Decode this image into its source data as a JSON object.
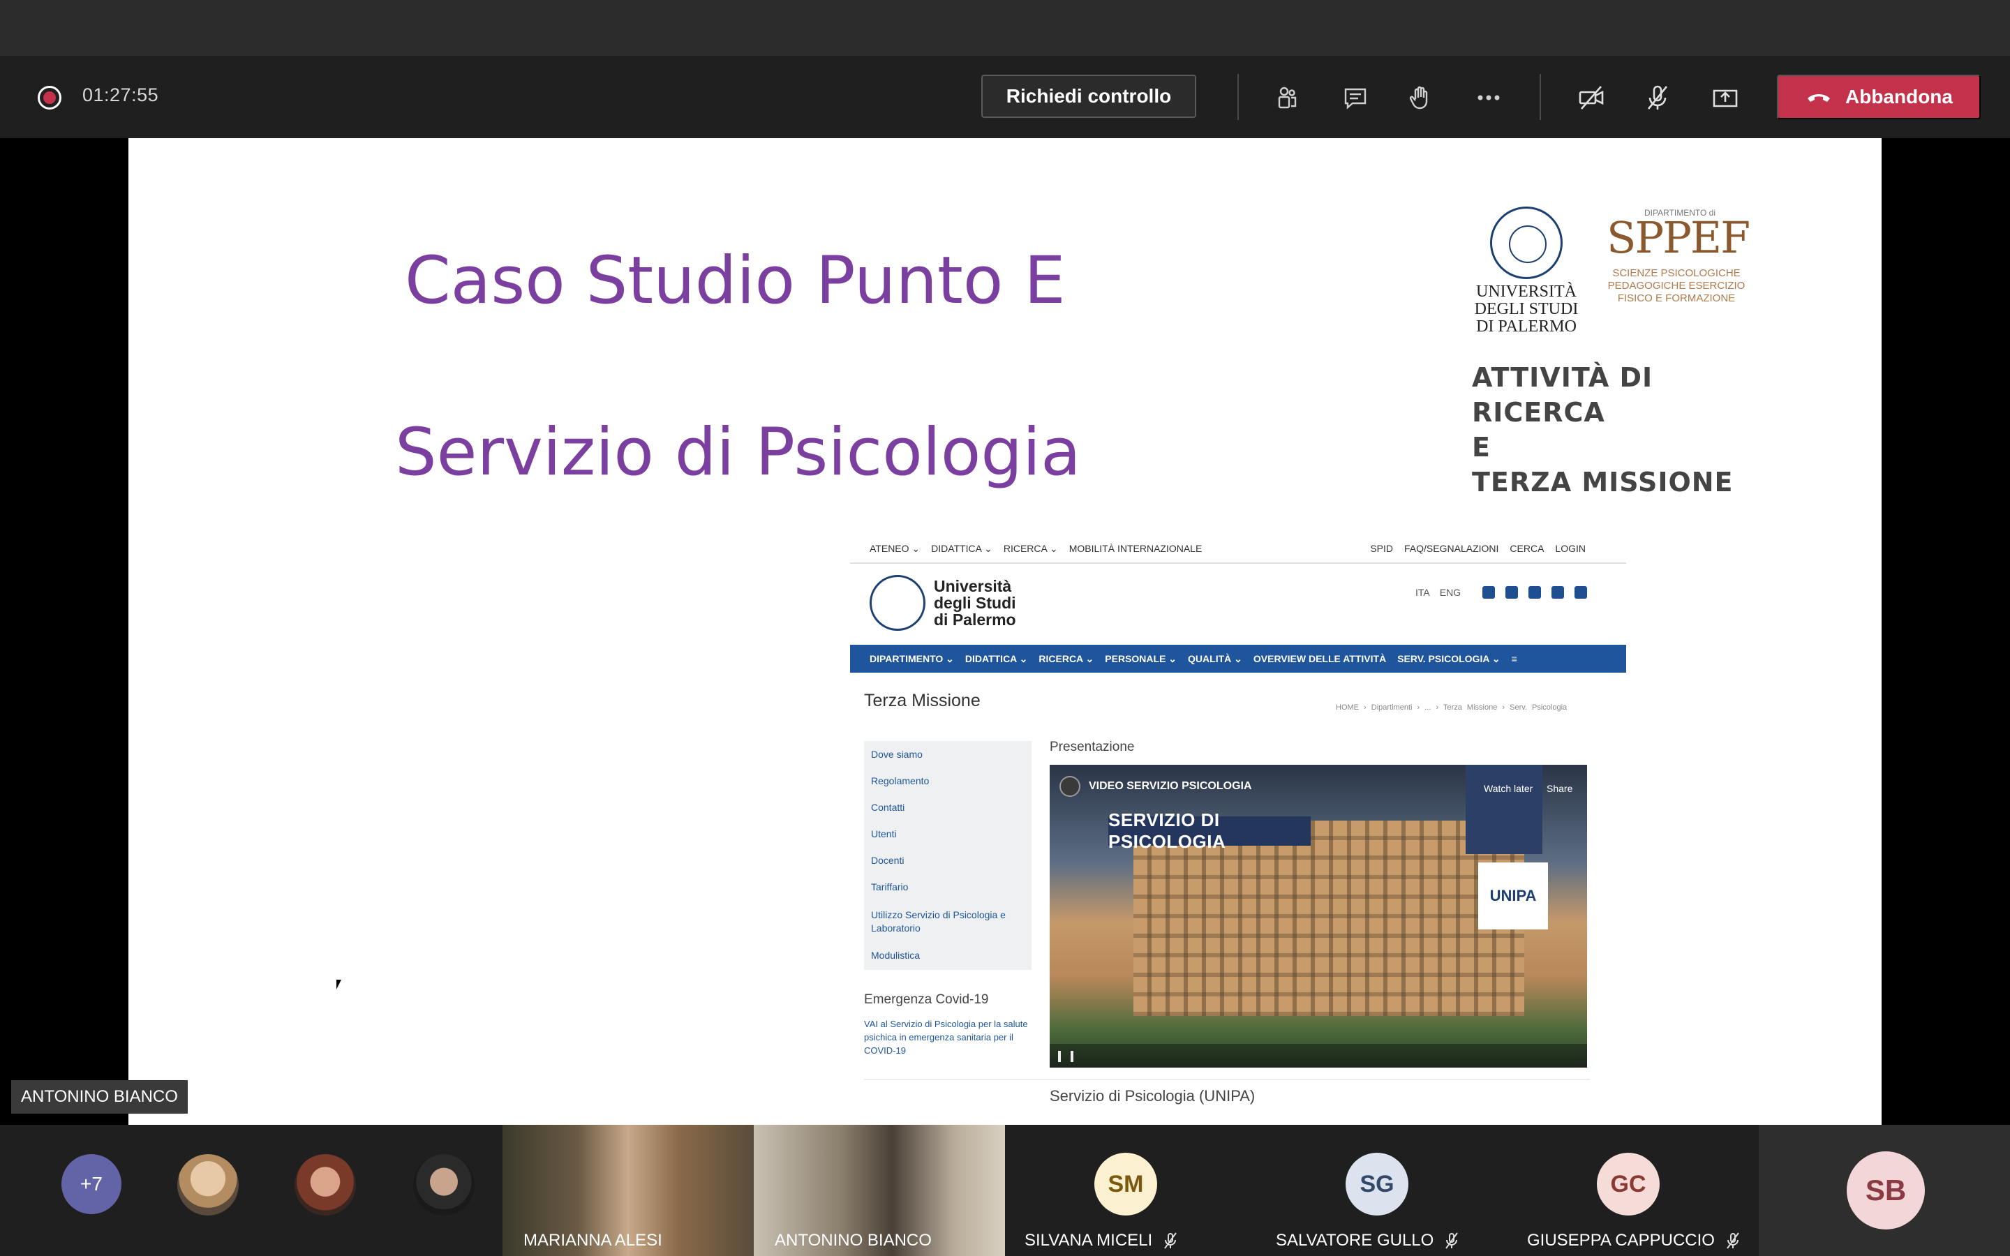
{
  "meeting": {
    "timer": "01:27:55",
    "request_control_label": "Richiedi controllo",
    "leave_label": "Abbandona",
    "toolbar_icons": [
      "participants-icon",
      "chat-icon",
      "raise-hand-icon",
      "more-options-icon",
      "camera-off-icon",
      "mic-off-icon",
      "share-screen-icon"
    ],
    "colors": {
      "leave": "#c4314b",
      "toolbar": "#1f1f1f",
      "more_badge": "#6264a7"
    }
  },
  "slide": {
    "title_line1": "Caso Studio Punto E",
    "title_line2": "Servizio di Psicologia",
    "title_color": "#7b3fa0",
    "unipa_logo_text": "UNIVERSITÀ\nDEGLI STUDI\nDI PALERMO",
    "sppef_dept_text": "DIPARTIMENTO di",
    "sppef_mark": "SPPEF",
    "sppef_sub": "SCIENZE PSICOLOGICHE PEDAGOGICHE ESERCIZIO FISICO E FORMAZIONE",
    "ricerca_line1": "ATTIVITÀ DI RICERCA",
    "ricerca_line2": "E",
    "ricerca_line3": "TERZA MISSIONE"
  },
  "website": {
    "top_left": [
      "ATENEO ⌄",
      "DIDATTICA ⌄",
      "RICERCA ⌄",
      "MOBILITÀ INTERNAZIONALE"
    ],
    "top_right": [
      "SPID",
      "FAQ/SEGNALAZIONI",
      "CERCA",
      "LOGIN"
    ],
    "brand_name": "Università degli Studi di Palermo",
    "lang_ita": "ITA",
    "lang_eng": "ENG",
    "nav": [
      "DIPARTIMENTO ⌄",
      "DIDATTICA ⌄",
      "RICERCA ⌄",
      "PERSONALE ⌄",
      "QUALITÀ ⌄",
      "OVERVIEW DELLE ATTIVITÀ",
      "SERV. PSICOLOGIA ⌄",
      "≡"
    ],
    "page_heading": "Terza Missione",
    "breadcrumb": "HOME › Dipartimenti › ... › Terza Missione › Serv. Psicologia",
    "menu": [
      "Dove siamo",
      "Regolamento",
      "Contatti",
      "Utenti",
      "Docenti",
      "Tariffario",
      "Utilizzo Servizio di Psicologia e Laboratorio",
      "Modulistica"
    ],
    "presentazione": "Presentazione",
    "video_title": "VIDEO SERVIZIO PSICOLOGIA",
    "video_banner": "SERVIZIO DI PSICOLOGIA",
    "watch_later": "Watch later",
    "share": "Share",
    "video_logo": "UNIPA",
    "emergenza_title": "Emergenza Covid-19",
    "emergenza_text": "VAI al Servizio di Psicologia per la salute psichica in emergenza sanitaria per il COVID-19",
    "servizio_heading": "Servizio di Psicologia (UNIPA)"
  },
  "speaker_tag": "ANTONINO BIANCO",
  "participants": {
    "more_count": "+7",
    "video_tiles": [
      {
        "name": "MARIANNA ALESI"
      },
      {
        "name": "ANTONINO BIANCO"
      }
    ],
    "avatar_tiles": [
      {
        "initials": "SM",
        "name": "SILVANA MICELI",
        "bg": "#fbf0cf",
        "fg": "#7a5a10"
      },
      {
        "initials": "SG",
        "name": "SALVATORE GULLO",
        "bg": "#dce3ee",
        "fg": "#34496a"
      },
      {
        "initials": "GC",
        "name": "GIUSEPPA CAPPUCCIO",
        "bg": "#f6dcd8",
        "fg": "#8a3a33"
      }
    ],
    "self_initials": "SB"
  }
}
